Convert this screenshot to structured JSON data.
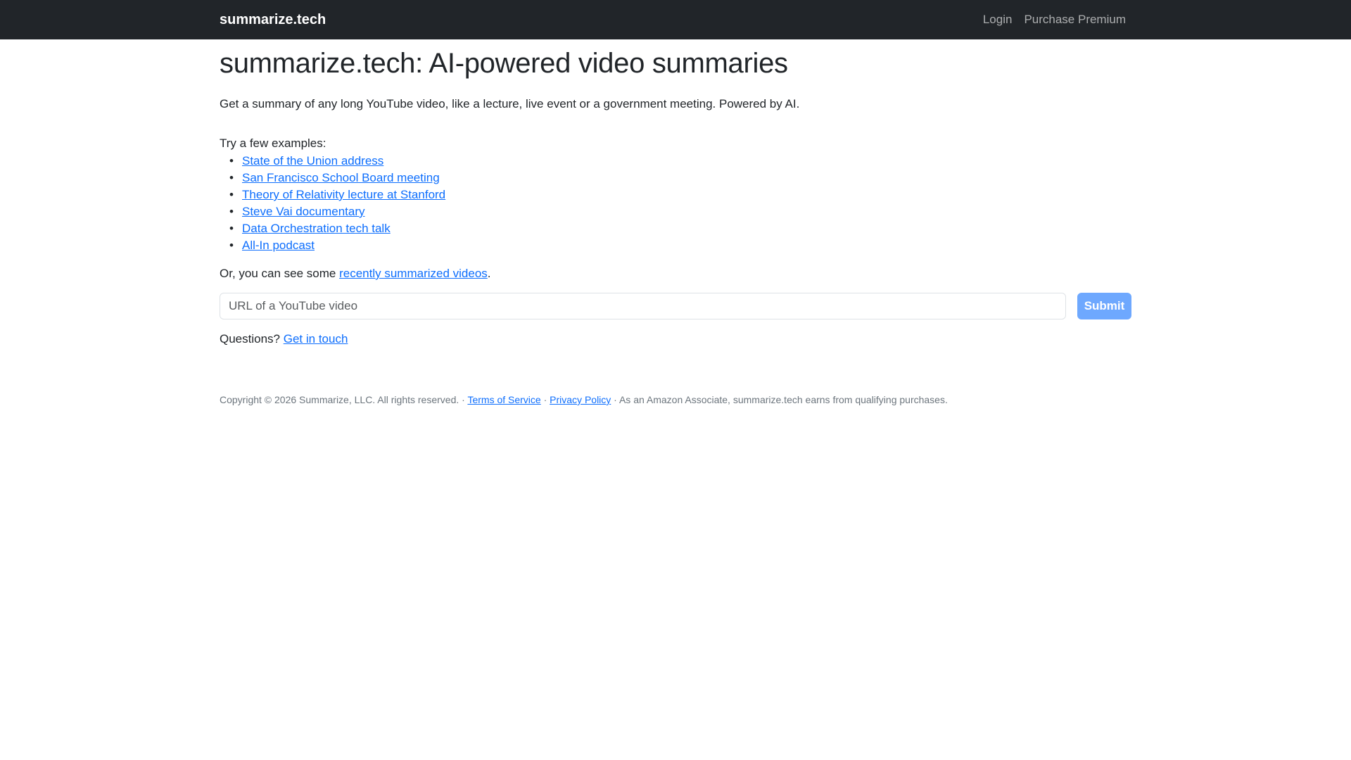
{
  "navbar": {
    "brand": "summarize.tech",
    "links": [
      "Login",
      "Purchase Premium"
    ]
  },
  "main": {
    "title": "summarize.tech: AI-powered video summaries",
    "intro": "Get a summary of any long YouTube video, like a lecture, live event or a government meeting. Powered by AI.",
    "examples_label": "Try a few examples:",
    "examples": [
      "State of the Union address",
      "San Francisco School Board meeting",
      "Theory of Relativity lecture at Stanford",
      "Steve Vai documentary",
      "Data Orchestration tech talk",
      "All-In podcast"
    ],
    "recent_prefix": "Or, you can see some ",
    "recent_link": "recently summarized videos",
    "recent_suffix": ".",
    "url_input_placeholder": "URL of a YouTube video",
    "url_input_value": "",
    "submit_label": "Submit",
    "questions_prefix": "Questions? ",
    "questions_link": "Get in touch"
  },
  "footer": {
    "copyright": "Copyright © 2026 Summarize, LLC. All rights reserved.",
    "separator": " · ",
    "terms": "Terms of Service",
    "privacy": "Privacy Policy",
    "amazon": "As an Amazon Associate, summarize.tech earns from qualifying purchases."
  },
  "colors": {
    "navbar_bg": "#212529",
    "link": "#0d6efd",
    "submit_bg": "#6ea8fe",
    "footer_text": "#6c757d"
  }
}
